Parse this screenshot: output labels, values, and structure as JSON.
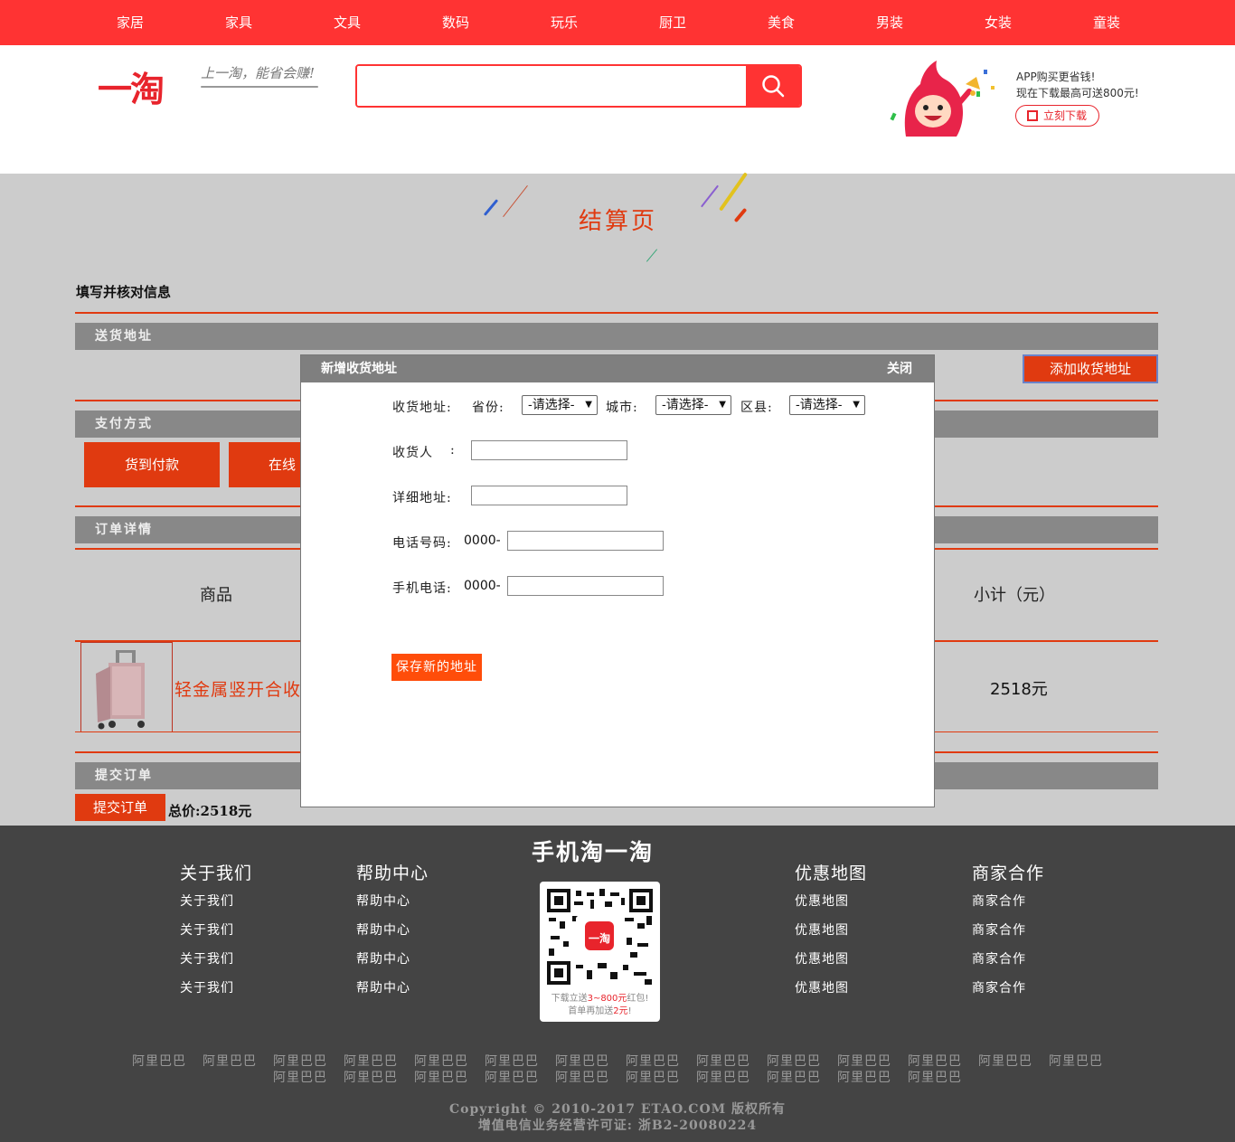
{
  "nav": [
    "家居",
    "家具",
    "文具",
    "数码",
    "玩乐",
    "厨卫",
    "美食",
    "男装",
    "女装",
    "童装"
  ],
  "header": {
    "logo": "一淘",
    "slogan": "上一淘，能省会赚!",
    "search_placeholder": "",
    "app_line1": "APP购买更省钱!",
    "app_line2": "现在下载最高可送800元!",
    "app_button": "立刻下载"
  },
  "page": {
    "title": "结算页",
    "subhead": "填写并核对信息",
    "sections": {
      "address": "送货地址",
      "payment": "支付方式",
      "order": "订单详情",
      "submit": "提交订单"
    },
    "add_address": "添加收货地址",
    "pay_options": [
      "货到付款",
      "在线"
    ],
    "table_headers": {
      "goods": "商品",
      "subtotal": "小计（元）"
    },
    "item": {
      "name": "轻金属竖开合收",
      "subtotal": "2518元"
    },
    "submit_button": "提交订单",
    "total": "总价:2518元"
  },
  "modal": {
    "title": "新增收货地址",
    "close": "关闭",
    "address_label": "收货地址:",
    "province_label": "省份:",
    "city_label": "城市:",
    "county_label": "区县:",
    "select_default": "-请选择-",
    "receiver_label": "收货人",
    "colon": ":",
    "detail_label": "详细地址:",
    "phone_label": "电话号码:",
    "mobile_label": "手机电话:",
    "phone_prefix": "0000-",
    "save_button": "保存新的地址"
  },
  "footer": {
    "about": {
      "title": "关于我们",
      "items": [
        "关于我们",
        "关于我们",
        "关于我们",
        "关于我们"
      ]
    },
    "help": {
      "title": "帮助中心",
      "items": [
        "帮助中心",
        "帮助中心",
        "帮助中心",
        "帮助中心"
      ]
    },
    "map": {
      "title": "优惠地图",
      "items": [
        "优惠地图",
        "优惠地图",
        "优惠地图",
        "优惠地图"
      ]
    },
    "biz": {
      "title": "商家合作",
      "items": [
        "商家合作",
        "商家合作",
        "商家合作",
        "商家合作"
      ]
    },
    "mobile_title": "手机淘一淘",
    "qr_logo": "一淘",
    "qr_line1_a": "下载立送",
    "qr_line1_b": "3~800元",
    "qr_line1_c": "红包!",
    "qr_line2_a": "首单再加送",
    "qr_line2_b": "2元",
    "qr_line2_c": "!",
    "links_row1": [
      "阿里巴巴",
      "阿里巴巴",
      "阿里巴巴",
      "阿里巴巴",
      "阿里巴巴",
      "阿里巴巴",
      "阿里巴巴",
      "阿里巴巴",
      "阿里巴巴",
      "阿里巴巴",
      "阿里巴巴",
      "阿里巴巴",
      "阿里巴巴",
      "阿里巴巴"
    ],
    "links_row2": [
      "阿里巴巴",
      "阿里巴巴",
      "阿里巴巴",
      "阿里巴巴",
      "阿里巴巴",
      "阿里巴巴",
      "阿里巴巴",
      "阿里巴巴",
      "阿里巴巴",
      "阿里巴巴"
    ],
    "copyright": "Copyright © 2010-2017 ETAO.COM 版权所有",
    "license": "增值电信业务经营许可证: 浙B2-20080224"
  }
}
